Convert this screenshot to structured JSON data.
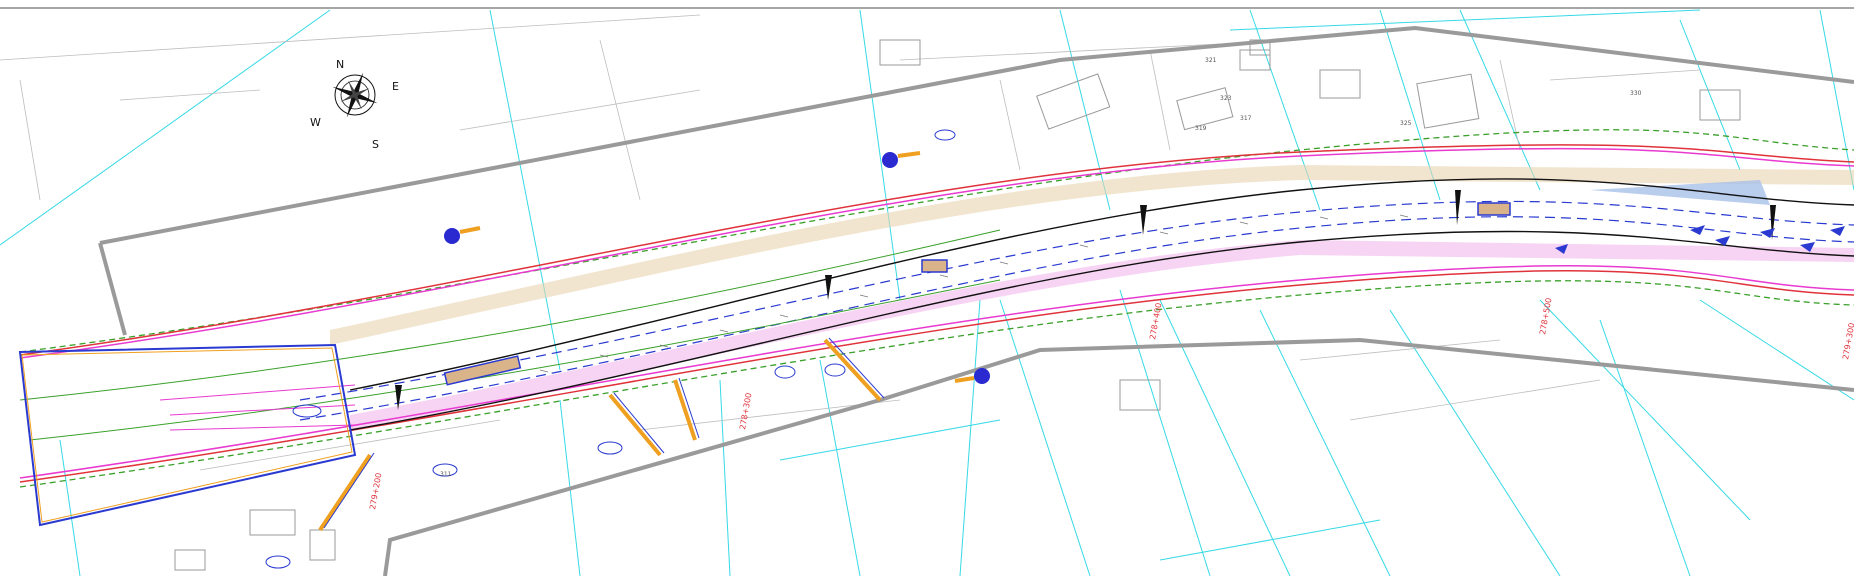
{
  "compass": {
    "n": "N",
    "e": "E",
    "s": "S",
    "w": "W"
  },
  "parcel_labels": [
    "321",
    "323",
    "325",
    "317",
    "319",
    "330",
    "311"
  ],
  "chainage_labels": [
    "278+300",
    "278+400",
    "279+200",
    "278+500",
    "279+300"
  ],
  "colors": {
    "outline": "#9a9a9a",
    "parcel": "#36d9e6",
    "road_edge": "#e0323a",
    "magenta": "#e83ad0",
    "green_dash": "#3aa02a",
    "blue_dash": "#2a3ad0",
    "hatch_pink": "#f3c2ee",
    "hatch_tan": "#e9d3b0",
    "orange": "#f0a020",
    "sign_blue": "#2a2ad0"
  }
}
